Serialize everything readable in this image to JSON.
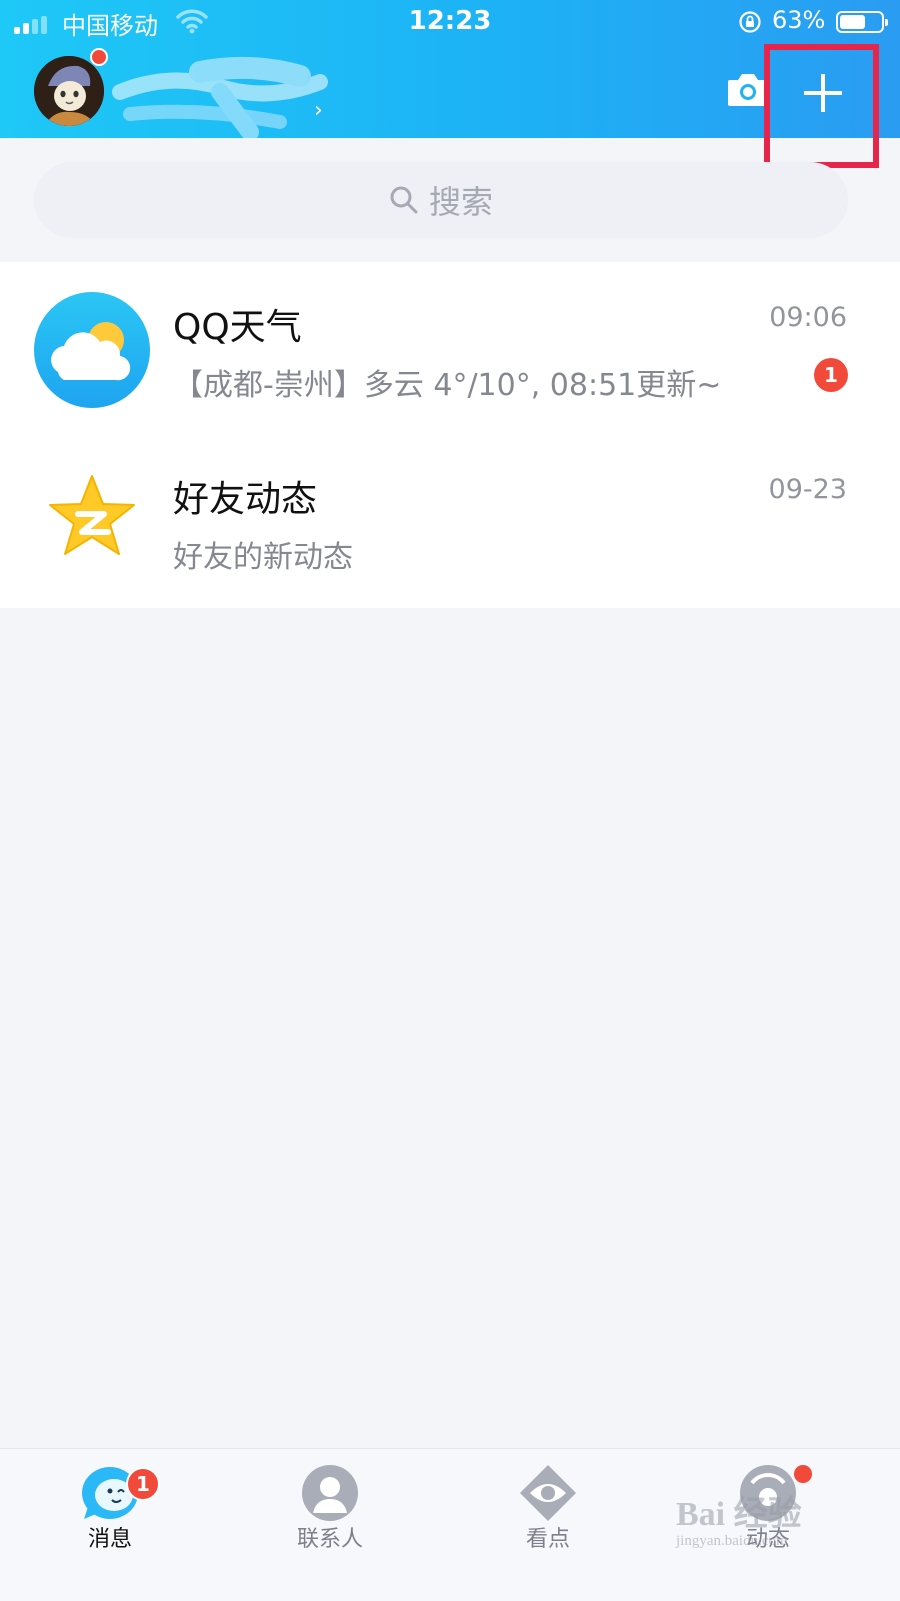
{
  "status_bar": {
    "carrier": "中国移动",
    "time": "12:23",
    "battery_percent": "63%",
    "battery_level": 0.63
  },
  "header": {
    "chevron": "›",
    "icons": [
      "avatar",
      "camera-icon",
      "plus-icon"
    ]
  },
  "search": {
    "placeholder": "搜索"
  },
  "conversations": [
    {
      "title": "QQ天气",
      "subtitle": "【成都-崇州】多云 4°/10°, 08:51更新~",
      "time": "09:06",
      "unread": "1",
      "icon": "weather-cloud-icon"
    },
    {
      "title": "好友动态",
      "subtitle": "好友的新动态",
      "time": "09-23",
      "icon": "qzone-star-icon"
    }
  ],
  "tabs": [
    {
      "label": "消息",
      "badge": "1",
      "active": true,
      "icon": "message-icon"
    },
    {
      "label": "联系人",
      "active": false,
      "icon": "contacts-icon"
    },
    {
      "label": "看点",
      "active": false,
      "icon": "eye-icon"
    },
    {
      "label": "动态",
      "active": false,
      "dot": true,
      "icon": "dynamic-icon"
    }
  ],
  "watermark": {
    "line1": "Bai 经验",
    "line2": "jingyan.baidu.com"
  },
  "colors": {
    "header_start": "#1ec8f7",
    "header_end": "#2a9cf2",
    "badge": "#f24a3a",
    "highlight": "#e7254b"
  }
}
